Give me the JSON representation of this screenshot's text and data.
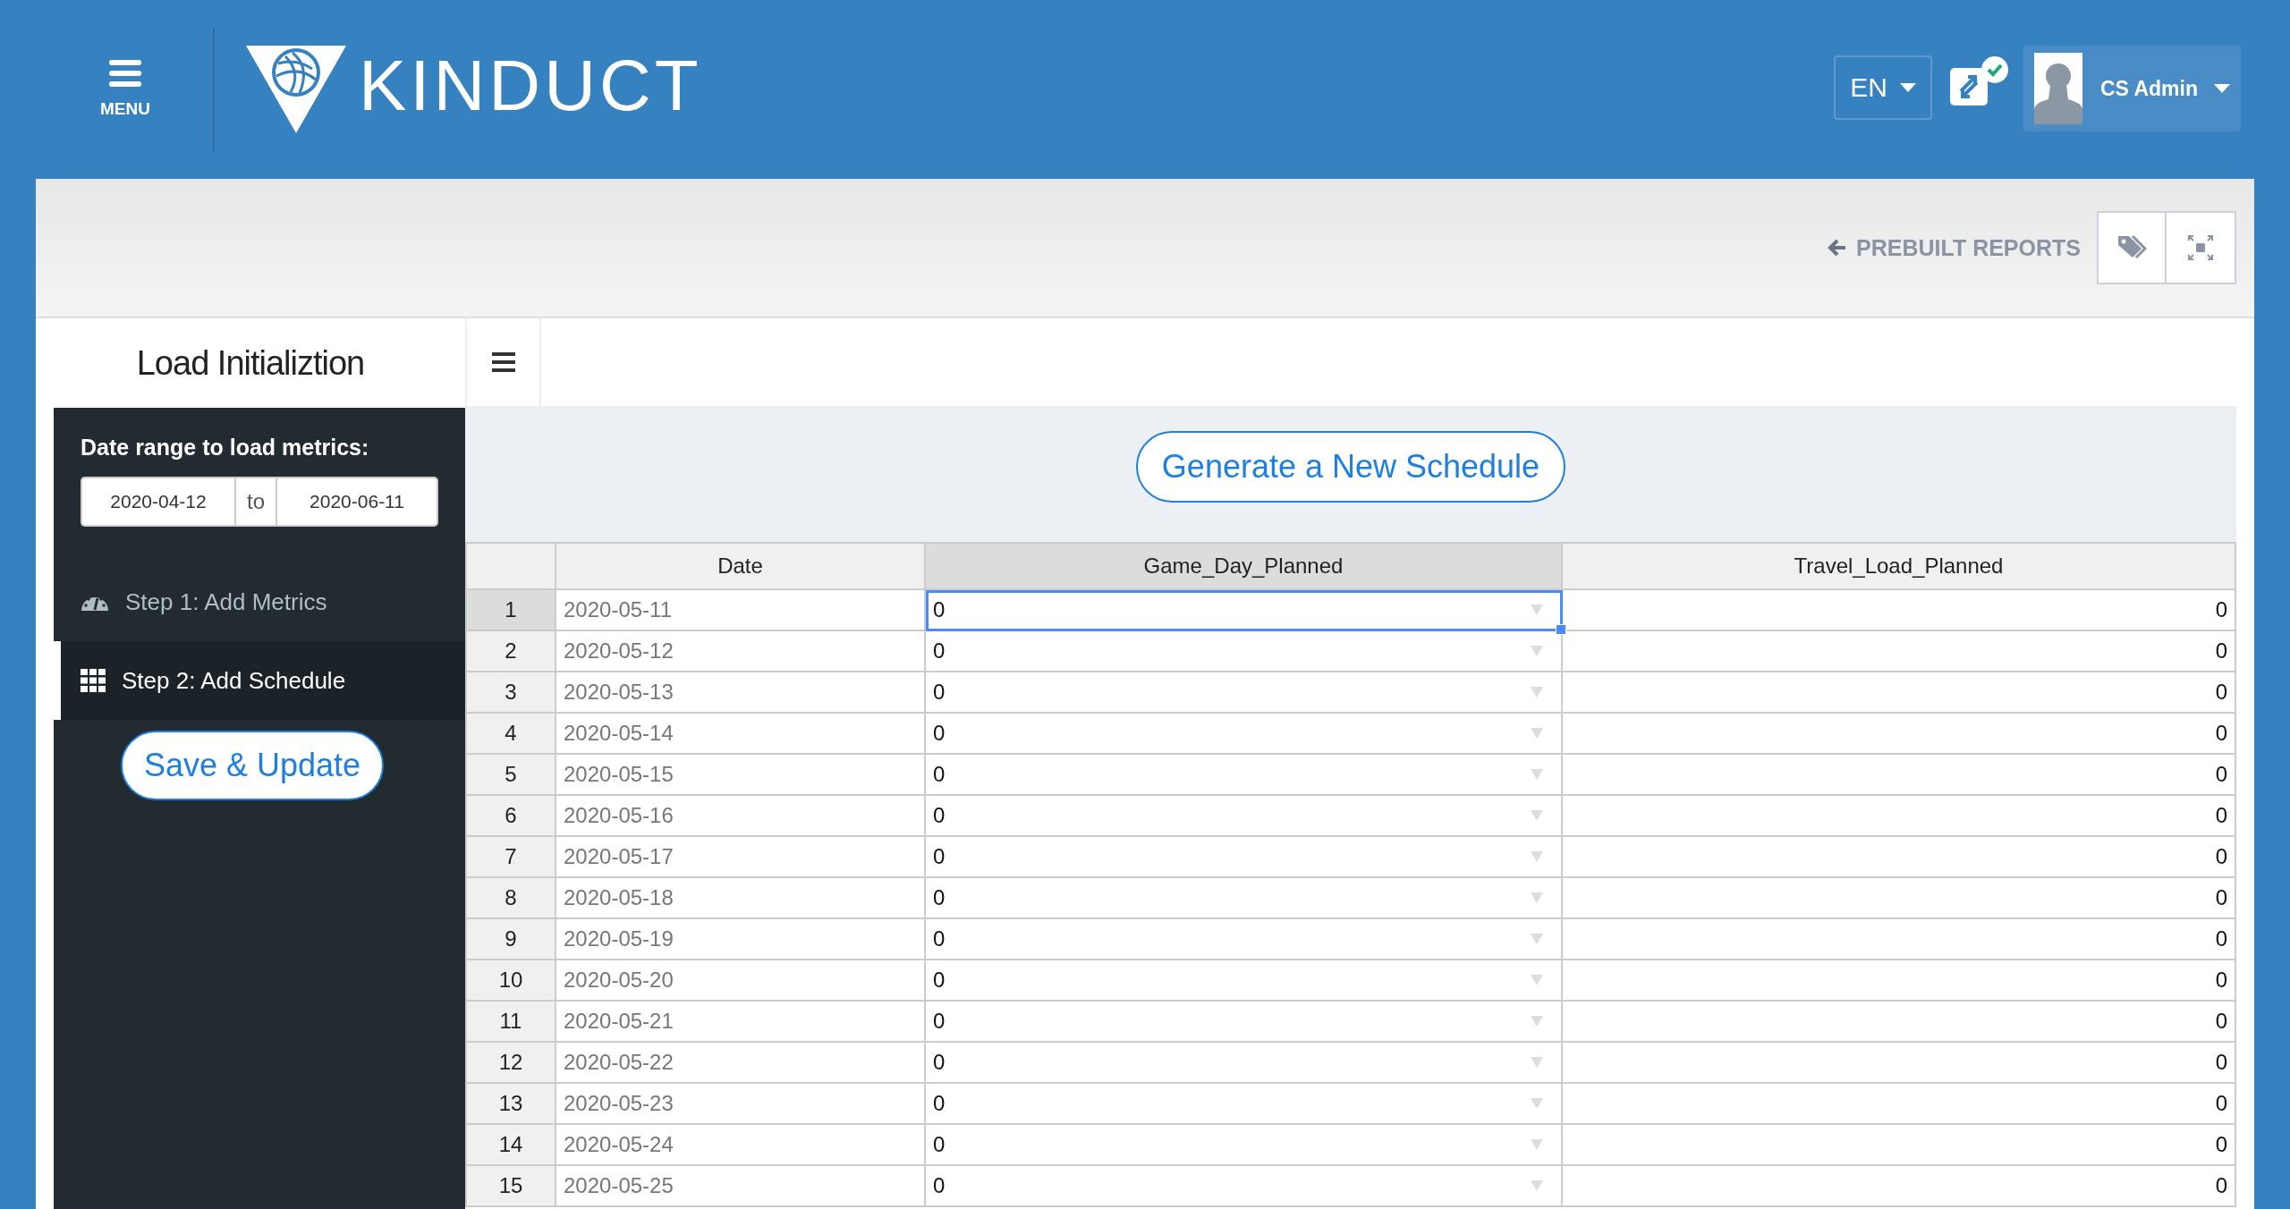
{
  "header": {
    "menu_label": "MENU",
    "logo_text": "KINDUCT",
    "language": "EN",
    "sync_ok": true,
    "user_name": "CS Admin"
  },
  "toolbar": {
    "back_link": "PREBUILT REPORTS"
  },
  "page_title": "Load Initializtion",
  "sidebar": {
    "date_range_label": "Date range to load metrics:",
    "start_date": "2020-04-12",
    "separator": "to",
    "end_date": "2020-06-11",
    "steps": [
      {
        "label": "Step 1: Add Metrics",
        "kind": "gauge",
        "selected": false
      },
      {
        "label": "Step 2: Add Schedule",
        "kind": "grid",
        "selected": true
      }
    ],
    "save_button": "Save & Update"
  },
  "generate_button": "Generate a New Schedule",
  "table": {
    "columns": [
      {
        "label": "Date",
        "kind": "date",
        "selected": false
      },
      {
        "label": "Game_Day_Planned",
        "kind": "dropdown",
        "selected": true
      },
      {
        "label": "Travel_Load_Planned",
        "kind": "number",
        "selected": false
      }
    ],
    "rows": [
      {
        "number": "1",
        "cells": [
          "2020-05-11",
          "0",
          "0"
        ],
        "selected": true
      },
      {
        "number": "2",
        "cells": [
          "2020-05-12",
          "0",
          "0"
        ],
        "selected": false
      },
      {
        "number": "3",
        "cells": [
          "2020-05-13",
          "0",
          "0"
        ],
        "selected": false
      },
      {
        "number": "4",
        "cells": [
          "2020-05-14",
          "0",
          "0"
        ],
        "selected": false
      },
      {
        "number": "5",
        "cells": [
          "2020-05-15",
          "0",
          "0"
        ],
        "selected": false
      },
      {
        "number": "6",
        "cells": [
          "2020-05-16",
          "0",
          "0"
        ],
        "selected": false
      },
      {
        "number": "7",
        "cells": [
          "2020-05-17",
          "0",
          "0"
        ],
        "selected": false
      },
      {
        "number": "8",
        "cells": [
          "2020-05-18",
          "0",
          "0"
        ],
        "selected": false
      },
      {
        "number": "9",
        "cells": [
          "2020-05-19",
          "0",
          "0"
        ],
        "selected": false
      },
      {
        "number": "10",
        "cells": [
          "2020-05-20",
          "0",
          "0"
        ],
        "selected": false
      },
      {
        "number": "11",
        "cells": [
          "2020-05-21",
          "0",
          "0"
        ],
        "selected": false
      },
      {
        "number": "12",
        "cells": [
          "2020-05-22",
          "0",
          "0"
        ],
        "selected": false
      },
      {
        "number": "13",
        "cells": [
          "2020-05-23",
          "0",
          "0"
        ],
        "selected": false
      },
      {
        "number": "14",
        "cells": [
          "2020-05-24",
          "0",
          "0"
        ],
        "selected": false
      },
      {
        "number": "15",
        "cells": [
          "2020-05-25",
          "0",
          "0"
        ],
        "selected": false
      }
    ]
  }
}
